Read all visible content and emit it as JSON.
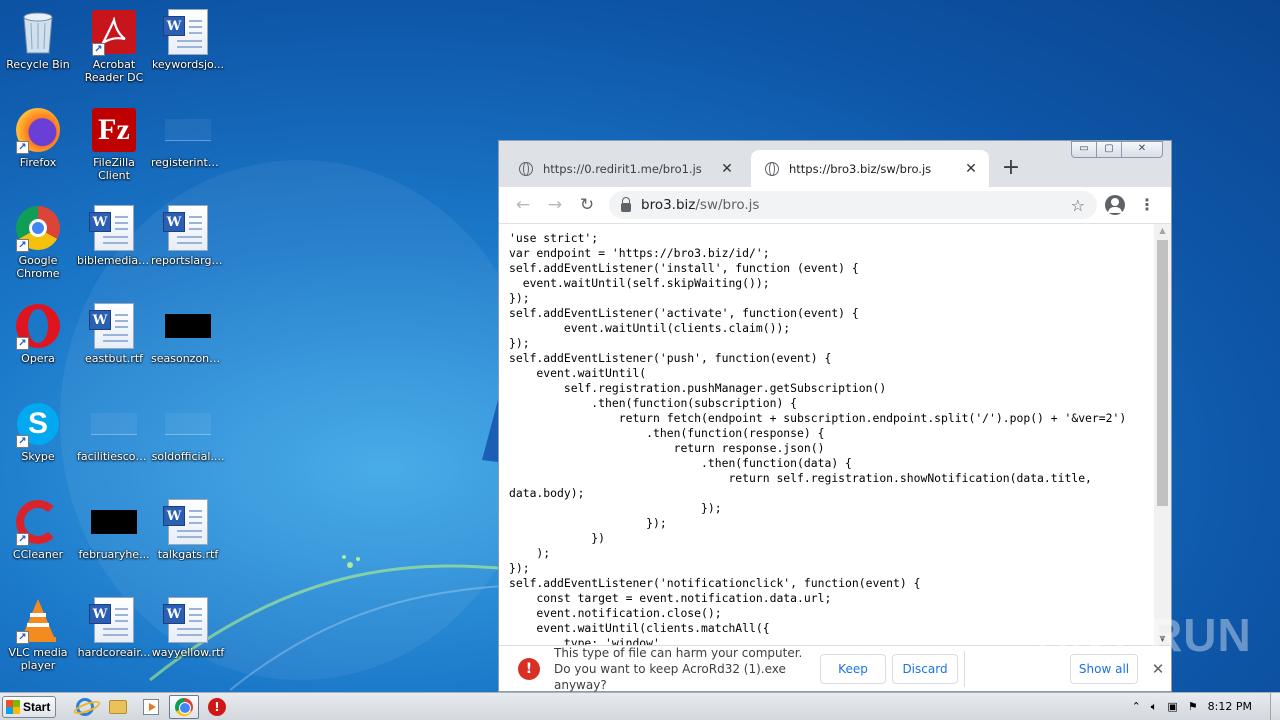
{
  "desktop": {
    "icons": [
      {
        "label": "Recycle Bin",
        "icon": "recycle-bin-icon"
      },
      {
        "label": "Acrobat Reader DC",
        "icon": "acrobat-icon"
      },
      {
        "label": "keywordsjo...",
        "icon": "word-doc-icon"
      },
      {
        "label": "Firefox",
        "icon": "firefox-icon"
      },
      {
        "label": "FileZilla Client",
        "icon": "filezilla-icon"
      },
      {
        "label": "registerinte...",
        "icon": "blank-file-icon"
      },
      {
        "label": "Google Chrome",
        "icon": "chrome-icon"
      },
      {
        "label": "biblemedia.rtf",
        "icon": "word-doc-icon"
      },
      {
        "label": "reportslarge...",
        "icon": "word-doc-icon"
      },
      {
        "label": "Opera",
        "icon": "opera-icon"
      },
      {
        "label": "eastbut.rtf",
        "icon": "word-doc-icon"
      },
      {
        "label": "seasonzone...",
        "icon": "black-file-icon"
      },
      {
        "label": "Skype",
        "icon": "skype-icon"
      },
      {
        "label": "facilitiescom...",
        "icon": "blank-file-icon"
      },
      {
        "label": "soldofficial....",
        "icon": "blank-file-icon"
      },
      {
        "label": "CCleaner",
        "icon": "ccleaner-icon"
      },
      {
        "label": "februaryhe...",
        "icon": "black-file-icon"
      },
      {
        "label": "talkgats.rtf",
        "icon": "word-doc-icon"
      },
      {
        "label": "VLC media player",
        "icon": "vlc-icon"
      },
      {
        "label": "hardcoreair...",
        "icon": "word-doc-icon"
      },
      {
        "label": "wayyellow.rtf",
        "icon": "word-doc-icon"
      }
    ]
  },
  "browser": {
    "tabs": [
      {
        "title": "https://0.redirit1.me/bro1.js",
        "active": false
      },
      {
        "title": "https://bro3.biz/sw/bro.js",
        "active": true
      }
    ],
    "window_controls": {
      "minimize": "▭",
      "maximize": "▢",
      "close": "✕"
    },
    "new_tab": "+",
    "nav": {
      "back": "←",
      "forward": "→",
      "reload": "↻"
    },
    "address": {
      "host": "bro3.biz",
      "path": "/sw/bro.js"
    },
    "star": "☆",
    "menu": "⋮",
    "code": "'use strict';\nvar endpoint = 'https://bro3.biz/id/';\nself.addEventListener('install', function (event) {\n  event.waitUntil(self.skipWaiting());\n});\nself.addEventListener('activate', function(event) {\n        event.waitUntil(clients.claim());\n});\nself.addEventListener('push', function(event) {\n    event.waitUntil(\n        self.registration.pushManager.getSubscription()\n            .then(function(subscription) {\n                return fetch(endpoint + subscription.endpoint.split('/').pop() + '&ver=2')\n                    .then(function(response) {\n                        return response.json()\n                            .then(function(data) {\n                                return self.registration.showNotification(data.title,\ndata.body);\n                            });\n                    });\n            })\n    );\n});\nself.addEventListener('notificationclick', function(event) {\n    const target = event.notification.data.url;\n    event.notification.close();\n    event.waitUntil(clients.matchAll({\n        type: 'window',",
    "download_bar": {
      "warning_icon": "!",
      "message": "This type of file can harm your computer. Do you want to keep AcroRd32 (1).exe anyway?",
      "keep": "Keep",
      "discard": "Discard",
      "show_all": "Show all",
      "close": "✕"
    }
  },
  "watermark": "ANY RUN",
  "taskbar": {
    "start_label": "Start",
    "clock": "8:12 PM"
  },
  "colors": {
    "desktop_blue": "#1b78c9",
    "warning_red": "#d93025",
    "link_blue": "#1a73e8"
  }
}
